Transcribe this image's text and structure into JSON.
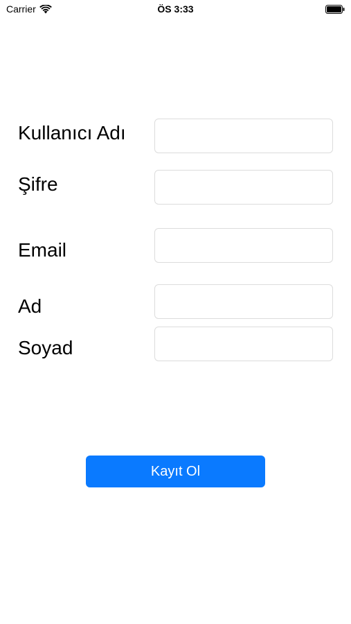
{
  "status_bar": {
    "carrier": "Carrier",
    "time": "ÖS 3:33",
    "icons": [
      "wifi-icon",
      "battery-icon"
    ]
  },
  "form": {
    "fields": [
      {
        "label": "Kullanıcı Adı",
        "value": "",
        "placeholder": ""
      },
      {
        "label": "Şifre",
        "value": "",
        "placeholder": ""
      },
      {
        "label": "Email",
        "value": "",
        "placeholder": ""
      },
      {
        "label": "Ad",
        "value": "",
        "placeholder": ""
      },
      {
        "label": "Soyad",
        "value": "",
        "placeholder": ""
      }
    ],
    "submit_label": "Kayıt Ol"
  },
  "colors": {
    "accent": "#0a7aff",
    "field_border": "#dcdcdc",
    "background": "#ffffff"
  }
}
